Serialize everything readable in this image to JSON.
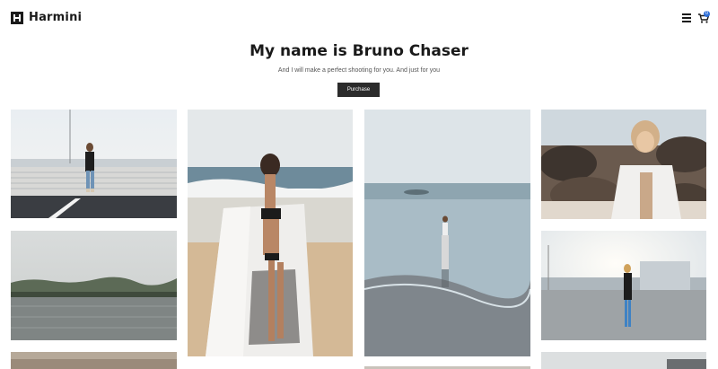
{
  "header": {
    "brand": "Harmini",
    "logo_icon": "logo-mark-icon",
    "menu_icon": "hamburger-menu-icon",
    "cart_icon": "shopping-cart-icon",
    "cart_count": "0"
  },
  "hero": {
    "title": "My name is Bruno Chaser",
    "subtitle": "And I will make a perfect shooting for you. And just for you",
    "button_label": "Purchase"
  },
  "colors": {
    "button_bg": "#2b2b2b",
    "badge": "#2e6fd8"
  },
  "gallery": [
    {
      "id": "photo-parking-lot-woman"
    },
    {
      "id": "photo-lake-forest"
    },
    {
      "id": "photo-partial-bottom-left"
    },
    {
      "id": "photo-beach-towel-woman"
    },
    {
      "id": "photo-shoreline-woman"
    },
    {
      "id": "photo-rocks-blonde-woman"
    },
    {
      "id": "photo-rooftop-woman"
    },
    {
      "id": "photo-partial-bottom-right"
    }
  ]
}
